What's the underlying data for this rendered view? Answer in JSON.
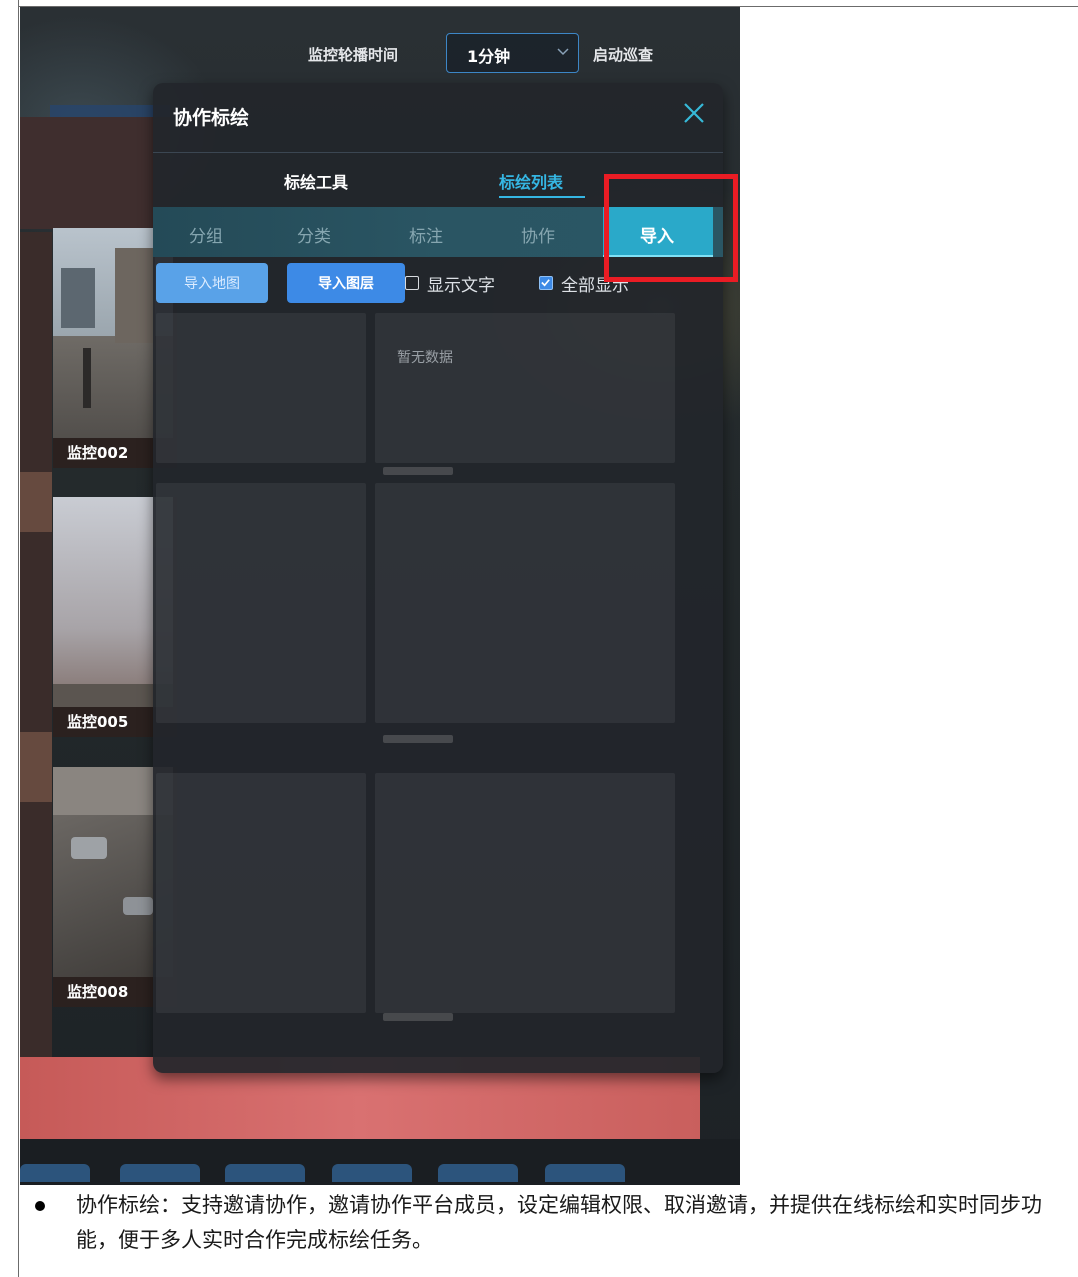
{
  "toolbar": {
    "interval_label": "监控轮播时间",
    "interval_value": "1分钟",
    "start_patrol_label": "启动巡查"
  },
  "panel": {
    "title": "协作标绘",
    "main_tabs": [
      {
        "label": "标绘工具",
        "active": false
      },
      {
        "label": "标绘列表",
        "active": true
      }
    ],
    "sub_tabs": [
      {
        "label": "分组",
        "active": false
      },
      {
        "label": "分类",
        "active": false
      },
      {
        "label": "标注",
        "active": false
      },
      {
        "label": "协作",
        "active": false
      },
      {
        "label": "导入",
        "active": true
      }
    ],
    "import_map_label": "导入地图",
    "import_layer_label": "导入图层",
    "show_text": {
      "label": "显示文字",
      "checked": false
    },
    "show_all": {
      "label": "全部显示",
      "checked": true
    },
    "empty_text": "暂无数据"
  },
  "monitors": [
    {
      "label": "监控002"
    },
    {
      "label": "监控005"
    },
    {
      "label": "监控008"
    }
  ],
  "colors": {
    "accent": "#35b6e3",
    "highlight_box": "#ea1c24",
    "primary_button": "#3d8ae6"
  },
  "document": {
    "paragraph": "协作标绘：支持邀请协作，邀请协作平台成员，设定编辑权限、取消邀请，并提供在线标绘和实时同步功能，便于多人实时合作完成标绘任务。"
  }
}
